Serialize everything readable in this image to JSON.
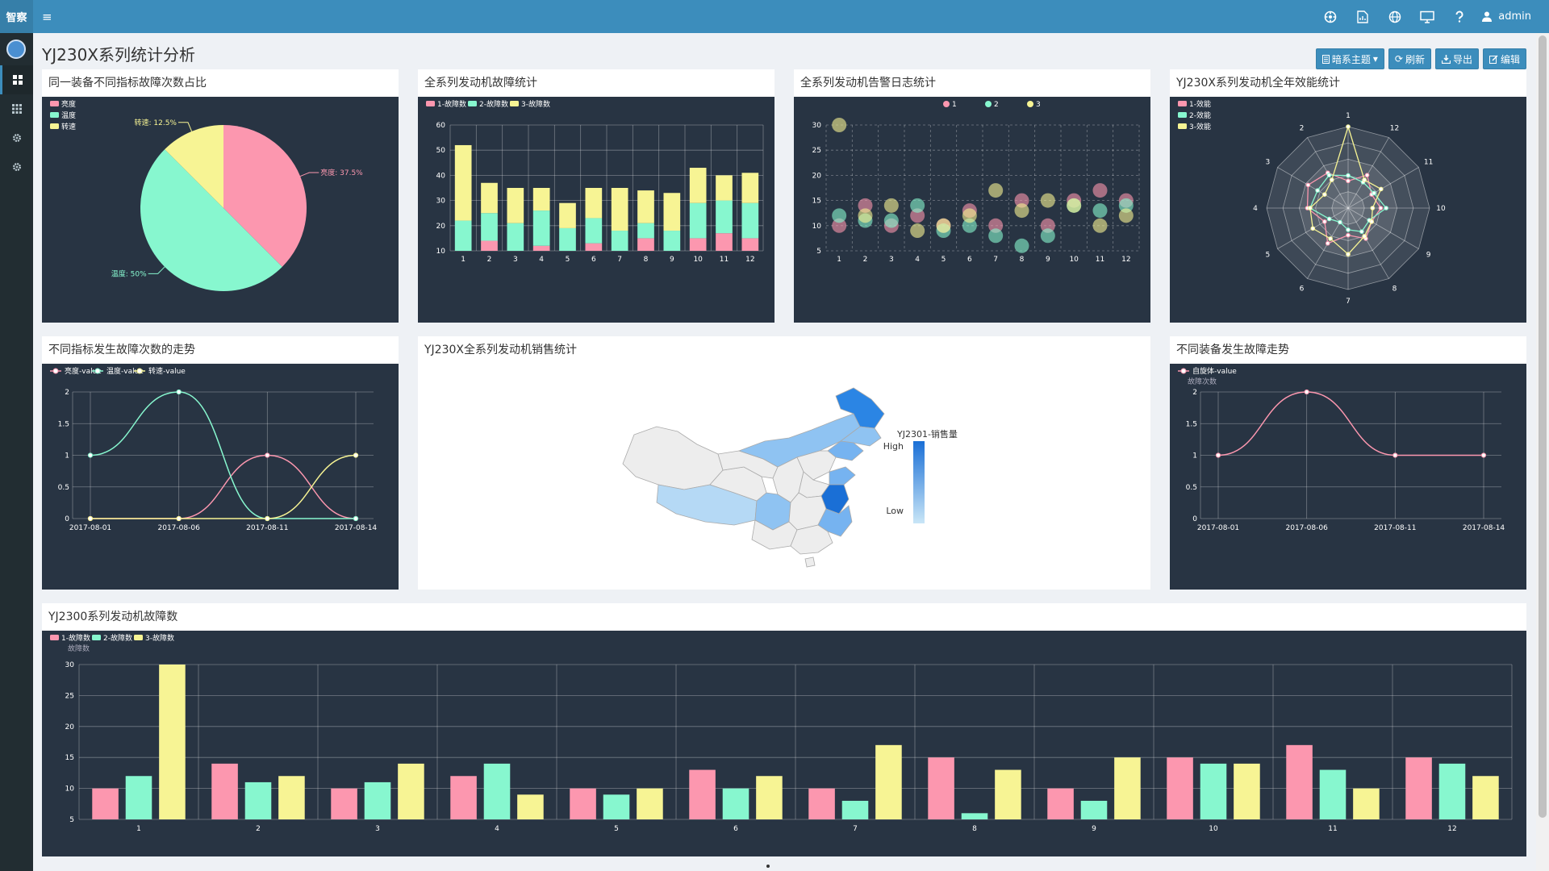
{
  "app": {
    "brand": "智察",
    "menu_toggle": "≡",
    "top_icons": [
      "dashboard-icon",
      "chart-file-icon",
      "globe-icon",
      "monitor-icon",
      "help-icon"
    ],
    "user": "admin"
  },
  "sidebar": {
    "items": [
      {
        "icon": "dashboard-icon",
        "active": true
      },
      {
        "icon": "grid-icon",
        "active": false
      },
      {
        "icon": "gear-icon",
        "active": false
      },
      {
        "icon": "gear-icon",
        "active": false
      }
    ]
  },
  "page": {
    "title": "YJ230X系列统计分析",
    "toolbar": {
      "theme": "暗系主题",
      "refresh": "刷新",
      "export": "导出",
      "edit": "编辑"
    }
  },
  "colors": {
    "pink": "#fc97af",
    "teal": "#87f7cf",
    "yellow": "#f7f494",
    "panel_bg": "#283443",
    "accent": "#3c8dbc",
    "map_dark": "#1a6fd6",
    "map_mid": "#76b3f0",
    "map_light": "#b5d9f5"
  },
  "panels": {
    "pie": {
      "title": "同一装备不同指标故障次数占比"
    },
    "stack": {
      "title": "全系列发动机故障统计"
    },
    "scatter": {
      "title": "全系列发动机告警日志统计"
    },
    "radar": {
      "title": "YJ230X系列发动机全年效能统计"
    },
    "trend": {
      "title": "不同指标发生故障次数的走势"
    },
    "map": {
      "title": "YJ230X全系列发动机销售统计",
      "legend_title": "YJ2301-销售量",
      "high": "High",
      "low": "Low"
    },
    "device": {
      "title": "不同装备发生故障走势"
    },
    "bottom": {
      "title": "YJ2300系列发动机故障数"
    }
  },
  "chart_data": [
    {
      "id": "pie",
      "type": "pie",
      "legend": [
        "亮度",
        "温度",
        "转速"
      ],
      "slices": [
        {
          "name": "亮度",
          "value": 37.5,
          "label": "亮度: 37.5%"
        },
        {
          "name": "温度",
          "value": 50,
          "label": "温度: 50%"
        },
        {
          "name": "转速",
          "value": 12.5,
          "label": "转速: 12.5%"
        }
      ]
    },
    {
      "id": "stack",
      "type": "bar",
      "stacked": true,
      "categories": [
        "1",
        "2",
        "3",
        "4",
        "5",
        "6",
        "7",
        "8",
        "9",
        "10",
        "11",
        "12"
      ],
      "series": [
        {
          "name": "1-故障数",
          "values": [
            10,
            14,
            10,
            12,
            10,
            13,
            10,
            15,
            10,
            15,
            17,
            15
          ]
        },
        {
          "name": "2-故障数",
          "values": [
            12,
            11,
            11,
            14,
            9,
            10,
            8,
            6,
            8,
            14,
            13,
            14
          ]
        },
        {
          "name": "3-故障数",
          "values": [
            30,
            12,
            14,
            9,
            10,
            12,
            17,
            13,
            15,
            14,
            10,
            12
          ]
        }
      ],
      "ylim": [
        10,
        60
      ],
      "yticks": [
        10,
        20,
        30,
        40,
        50,
        60
      ]
    },
    {
      "id": "scatter",
      "type": "scatter",
      "legend": [
        "1",
        "2",
        "3"
      ],
      "categories": [
        "1",
        "2",
        "3",
        "4",
        "5",
        "6",
        "7",
        "8",
        "9",
        "10",
        "11",
        "12"
      ],
      "series": [
        {
          "name": "1",
          "points": [
            [
              1,
              10
            ],
            [
              2,
              14
            ],
            [
              3,
              10
            ],
            [
              4,
              12
            ],
            [
              5,
              10
            ],
            [
              6,
              13
            ],
            [
              7,
              10
            ],
            [
              8,
              15
            ],
            [
              9,
              10
            ],
            [
              10,
              15
            ],
            [
              11,
              17
            ],
            [
              12,
              15
            ]
          ]
        },
        {
          "name": "2",
          "points": [
            [
              1,
              12
            ],
            [
              2,
              11
            ],
            [
              3,
              11
            ],
            [
              4,
              14
            ],
            [
              5,
              9
            ],
            [
              6,
              10
            ],
            [
              7,
              8
            ],
            [
              8,
              6
            ],
            [
              9,
              8
            ],
            [
              10,
              14
            ],
            [
              11,
              13
            ],
            [
              12,
              14
            ]
          ]
        },
        {
          "name": "3",
          "points": [
            [
              1,
              30
            ],
            [
              2,
              12
            ],
            [
              3,
              14
            ],
            [
              4,
              9
            ],
            [
              5,
              10
            ],
            [
              6,
              12
            ],
            [
              7,
              17
            ],
            [
              8,
              13
            ],
            [
              9,
              15
            ],
            [
              10,
              14
            ],
            [
              11,
              10
            ],
            [
              12,
              12
            ]
          ]
        }
      ],
      "ylim": [
        5,
        30
      ],
      "yticks": [
        5,
        10,
        15,
        20,
        25,
        30
      ]
    },
    {
      "id": "radar",
      "type": "radar",
      "legend": [
        "1-效能",
        "2-效能",
        "3-效能"
      ],
      "axes": [
        "1",
        "12",
        "11",
        "10",
        "9",
        "8",
        "7",
        "6",
        "5",
        "4",
        "3",
        "2"
      ],
      "max": 30,
      "series": [
        {
          "name": "1-效能",
          "values": [
            10,
            14,
            10,
            12,
            10,
            13,
            10,
            15,
            10,
            15,
            17,
            15
          ]
        },
        {
          "name": "2-效能",
          "values": [
            12,
            11,
            11,
            14,
            9,
            10,
            8,
            6,
            8,
            14,
            13,
            14
          ]
        },
        {
          "name": "3-效能",
          "values": [
            30,
            12,
            14,
            9,
            10,
            12,
            17,
            13,
            15,
            14,
            10,
            12
          ]
        }
      ]
    },
    {
      "id": "trend",
      "type": "line",
      "legend": [
        "亮度-value",
        "温度-value",
        "转速-value"
      ],
      "x": [
        "2017-08-01",
        "2017-08-06",
        "2017-08-11",
        "2017-08-14"
      ],
      "series": [
        {
          "name": "亮度-value",
          "values": [
            0,
            0,
            1,
            0
          ]
        },
        {
          "name": "温度-value",
          "values": [
            1,
            2,
            0,
            0
          ]
        },
        {
          "name": "转速-value",
          "values": [
            0,
            0,
            0,
            1
          ]
        }
      ],
      "ylim": [
        0,
        2
      ],
      "yticks": [
        "0",
        "0.5",
        "1",
        "1.5",
        "2"
      ]
    },
    {
      "id": "device",
      "type": "line",
      "legend": [
        "自旋体-value"
      ],
      "ylabel": "故障次数",
      "x": [
        "2017-08-01",
        "2017-08-06",
        "2017-08-11",
        "2017-08-14"
      ],
      "series": [
        {
          "name": "自旋体-value",
          "values": [
            1,
            2,
            1,
            1
          ]
        }
      ],
      "ylim": [
        0,
        2
      ],
      "yticks": [
        "0",
        "0.5",
        "1",
        "1.5",
        "2"
      ]
    },
    {
      "id": "bottom",
      "type": "bar",
      "legend": [
        "1-故障数",
        "2-故障数",
        "3-故障数"
      ],
      "ylabel": "故障数",
      "categories": [
        "1",
        "2",
        "3",
        "4",
        "5",
        "6",
        "7",
        "8",
        "9",
        "10",
        "11",
        "12"
      ],
      "series": [
        {
          "name": "1-故障数",
          "values": [
            10,
            14,
            10,
            12,
            10,
            13,
            10,
            15,
            10,
            15,
            17,
            15
          ]
        },
        {
          "name": "2-故障数",
          "values": [
            12,
            11,
            11,
            14,
            9,
            10,
            8,
            6,
            8,
            14,
            13,
            14
          ]
        },
        {
          "name": "3-故障数",
          "values": [
            30,
            12,
            14,
            9,
            10,
            12,
            17,
            13,
            15,
            14,
            10,
            12
          ]
        }
      ],
      "ylim": [
        5,
        30
      ],
      "yticks": [
        5,
        10,
        15,
        20,
        25,
        30
      ]
    }
  ]
}
